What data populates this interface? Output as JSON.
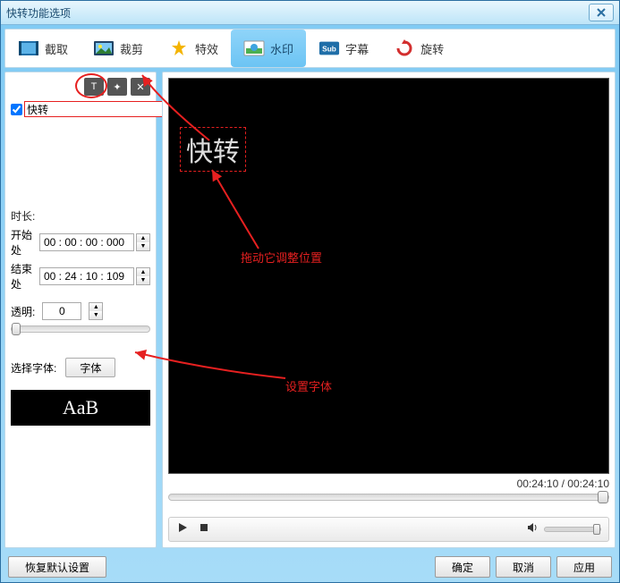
{
  "window": {
    "title": "快转功能选项"
  },
  "tabs": [
    {
      "label": "截取"
    },
    {
      "label": "裁剪"
    },
    {
      "label": "特效"
    },
    {
      "label": "水印"
    },
    {
      "label": "字幕"
    },
    {
      "label": "旋转"
    }
  ],
  "watermark": {
    "text": "快转"
  },
  "labels": {
    "duration": "时长:",
    "start": "开始处",
    "end": "结束处",
    "opacity": "透明:",
    "font_select": "选择字体:",
    "font_btn": "字体"
  },
  "times": {
    "start": "00 : 00 : 00 : 000",
    "end": "00 : 24 : 10 : 109"
  },
  "opacity": {
    "value": "0"
  },
  "font": {
    "preview": "AaB"
  },
  "player": {
    "time_display": "00:24:10 / 00:24:10"
  },
  "annotations": {
    "drag": "拖动它调整位置",
    "font": "设置字体"
  },
  "buttons": {
    "reset": "恢复默认设置",
    "ok": "确定",
    "cancel": "取消",
    "apply": "应用"
  }
}
